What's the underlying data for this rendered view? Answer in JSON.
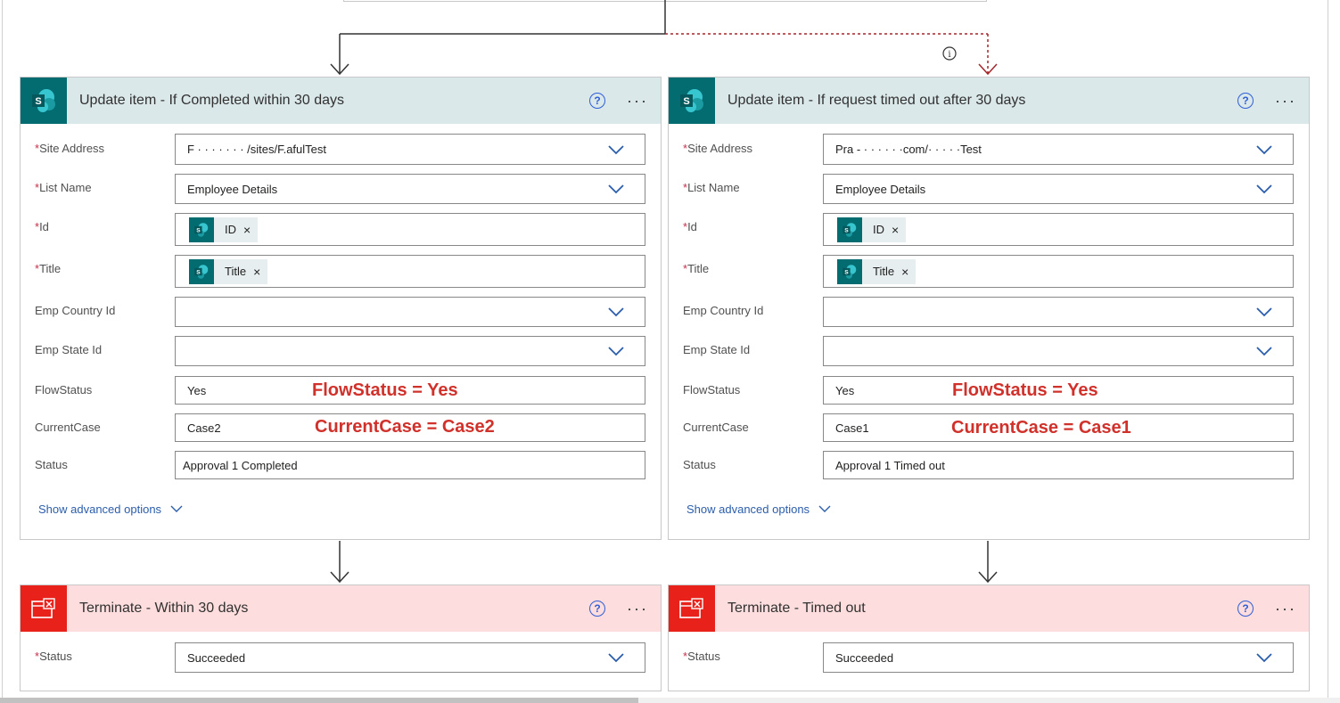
{
  "cards": {
    "left_update": {
      "title": "Update item - If Completed within 30 days",
      "help": "?",
      "more": "···",
      "fields": {
        "site_address": {
          "label": "Site Address",
          "value": "F          ·    ·  ·  · · ·        ·               /sites/F.afulTest"
        },
        "list_name": {
          "label": "List Name",
          "value": "Employee Details"
        },
        "id": {
          "label": "Id",
          "token": "ID",
          "remove": "×"
        },
        "title": {
          "label": "Title",
          "token": "Title",
          "remove": "×"
        },
        "emp_country": {
          "label": "Emp Country Id",
          "value": ""
        },
        "emp_state": {
          "label": "Emp State Id",
          "value": ""
        },
        "flow_status": {
          "label": "FlowStatus",
          "value": "Yes",
          "annotation": "FlowStatus = Yes"
        },
        "current_case": {
          "label": "CurrentCase",
          "value": "Case2",
          "annotation": "CurrentCase = Case2"
        },
        "status": {
          "label": "Status",
          "value": "Approval 1 Completed"
        }
      },
      "advanced": "Show advanced options"
    },
    "right_update": {
      "title": "Update item - If request timed out after 30 days",
      "help": "?",
      "more": "···",
      "fields": {
        "site_address": {
          "label": "Site Address",
          "value": "Pra          -  ·  ·  ·       ·  ·         ·com/·  ·  ·  ·  ·Test"
        },
        "list_name": {
          "label": "List Name",
          "value": "Employee Details"
        },
        "id": {
          "label": "Id",
          "token": "ID",
          "remove": "×"
        },
        "title": {
          "label": "Title",
          "token": "Title",
          "remove": "×"
        },
        "emp_country": {
          "label": "Emp Country Id",
          "value": ""
        },
        "emp_state": {
          "label": "Emp State Id",
          "value": ""
        },
        "flow_status": {
          "label": "FlowStatus",
          "value": "Yes",
          "annotation": "FlowStatus = Yes"
        },
        "current_case": {
          "label": "CurrentCase",
          "value": "Case1",
          "annotation": "CurrentCase = Case1"
        },
        "status": {
          "label": "Status",
          "value": "Approval 1 Timed out"
        }
      },
      "advanced": "Show advanced options"
    },
    "left_terminate": {
      "title": "Terminate - Within 30 days",
      "help": "?",
      "more": "···",
      "fields": {
        "status": {
          "label": "Status",
          "value": "Succeeded"
        }
      }
    },
    "right_terminate": {
      "title": "Terminate - Timed out",
      "help": "?",
      "more": "···",
      "fields": {
        "status": {
          "label": "Status",
          "value": "Succeeded"
        }
      }
    }
  },
  "required_mark": "*",
  "info_glyph": "i",
  "colors": {
    "sharepoint_teal": "#036c70",
    "sp_header_bg": "#dae8ea",
    "terminate_red": "#e8211b",
    "terminate_header_bg": "#fddddd",
    "annotation_red": "#d1312b",
    "timeout_branch": "#a4262c",
    "link_blue": "#2b5dab"
  }
}
